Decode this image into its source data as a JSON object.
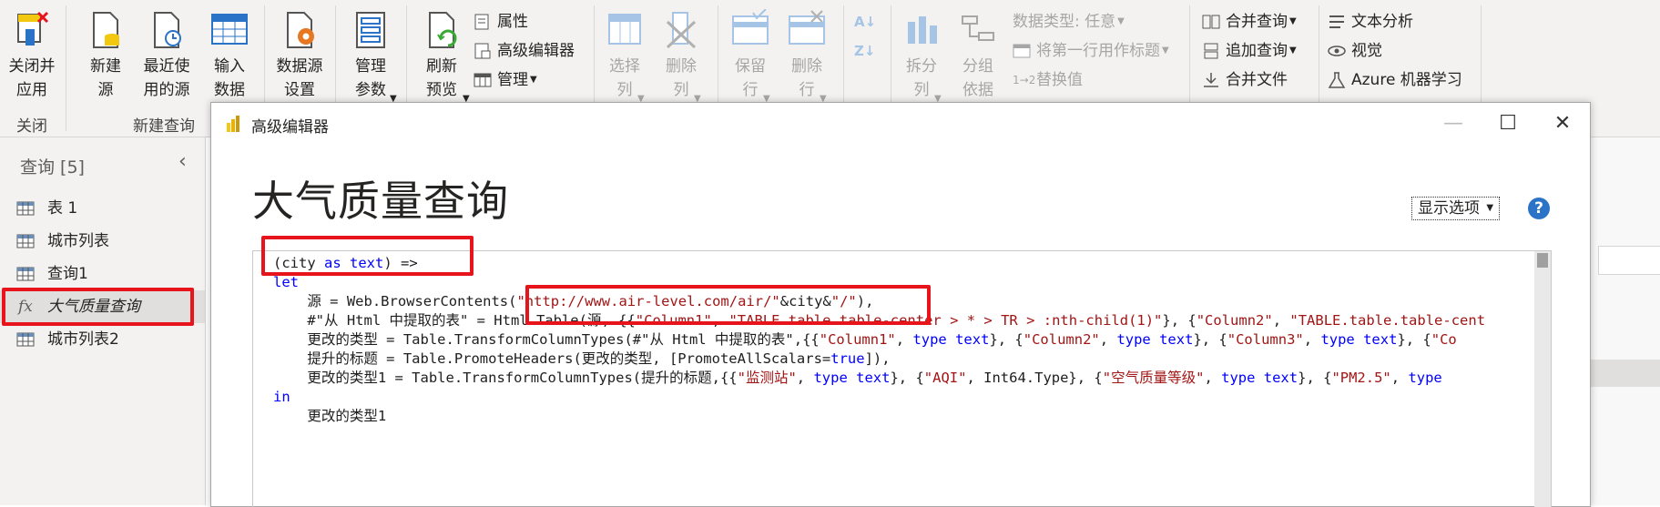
{
  "ribbon": {
    "close_group": {
      "close_apply": "关闭并\n应用",
      "label": "关闭"
    },
    "new_query_group": {
      "new_source": "新建\n源",
      "recent_sources": "最近使\n用的源",
      "enter_data": "输入\n数据",
      "label": "新建查询"
    },
    "data_source_settings": "数据源\n设置",
    "manage_params": "管理\n参数",
    "refresh_preview": "刷新\n预览",
    "properties": "属性",
    "advanced_editor": "高级编辑器",
    "manage": "管理",
    "choose_columns": "选择\n列",
    "remove_columns": "删除\n列",
    "keep_rows": "保留\n行",
    "remove_rows": "删除\n行",
    "split_column": "拆分\n列",
    "group_by": "分组\n依据",
    "data_type": "数据类型: 任意",
    "first_row_headers": "将第一行用作标题",
    "replace_values": "替换值",
    "merge_queries": "合并查询",
    "append_queries": "追加查询",
    "combine_files": "合并文件",
    "text_analytics": "文本分析",
    "vision": "视觉",
    "azure_ml": "Azure 机器学习"
  },
  "query_pane": {
    "title": "查询 [5]",
    "items": [
      {
        "label": "表 1",
        "icon": "table-icon"
      },
      {
        "label": "城市列表",
        "icon": "table-icon"
      },
      {
        "label": "查询1",
        "icon": "table-icon"
      },
      {
        "label": "大气质量查询",
        "icon": "fx-icon"
      },
      {
        "label": "城市列表2",
        "icon": "table-icon"
      }
    ],
    "fx_glyph": "fx"
  },
  "dialog": {
    "title": "高级编辑器",
    "heading": "大气质量查询",
    "show_options": "显示选项",
    "help": "?",
    "code": {
      "l1_a": "(city ",
      "l1_kw": "as",
      "l1_b": " ",
      "l1_type": "text",
      "l1_c": ") =>",
      "l2": "let",
      "l3_a": "    源 = Web.BrowserContents(",
      "l3_s1": "\"http://www.air-level.com/air/\"",
      "l3_b": "&city&",
      "l3_s2": "\"/\"",
      "l3_c": "),",
      "l4_a": "    #\"从 Html 中提取的表\" = Html.Table(源, {{",
      "l4_s1": "\"Column1\"",
      "l4_b": ", ",
      "l4_s2": "\"TABLE.table.table-center > * > TR > :nth-child(1)\"",
      "l4_c": "}, {",
      "l4_s3": "\"Column2\"",
      "l4_d": ", ",
      "l4_s4": "\"TABLE.table.table-cent",
      "l5_a": "    更改的类型 = Table.TransformColumnTypes(#\"从 Html 中提取的表\",{{",
      "l5_s1": "\"Column1\"",
      "l5_b": ", ",
      "l5_t1": "type text",
      "l5_c": "}, {",
      "l5_s2": "\"Column2\"",
      "l5_d": ", ",
      "l5_t2": "type text",
      "l5_e": "}, {",
      "l5_s3": "\"Column3\"",
      "l5_f": ", ",
      "l5_t3": "type text",
      "l5_g": "}, {",
      "l5_s4": "\"Co",
      "l6_a": "    提升的标题 = Table.PromoteHeaders(更改的类型, [PromoteAllScalars=",
      "l6_kw": "true",
      "l6_b": "]),",
      "l7_a": "    更改的类型1 = Table.TransformColumnTypes(提升的标题,{{",
      "l7_s1": "\"监测站\"",
      "l7_b": ", ",
      "l7_t1": "type text",
      "l7_c": "}, {",
      "l7_s2": "\"AQI\"",
      "l7_d": ", Int64.Type}, {",
      "l7_s3": "\"空气质量等级\"",
      "l7_e": ", ",
      "l7_t2": "type text",
      "l7_f": "}, {",
      "l7_s4": "\"PM2.5\"",
      "l7_g": ", ",
      "l7_t3": "type",
      "l8": "in",
      "l9": "    更改的类型1"
    }
  },
  "colors": {
    "accent_red": "#e8141b",
    "keyword_blue": "#0000ff",
    "string_red": "#a31515"
  }
}
